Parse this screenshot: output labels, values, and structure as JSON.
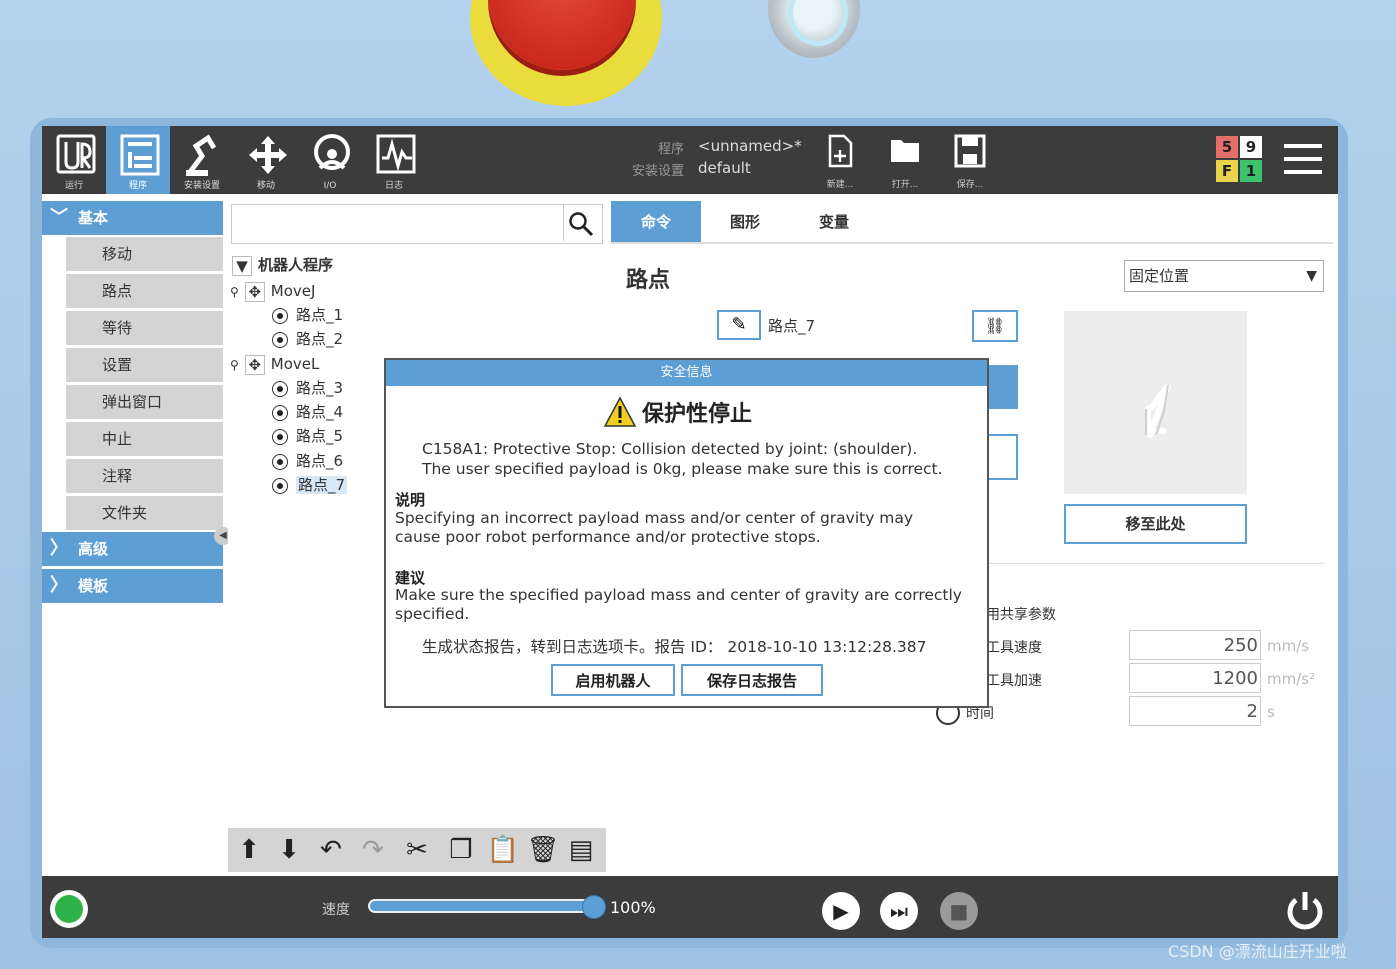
{
  "topbar": {
    "nav": [
      {
        "label": "运行",
        "icon": "ur-logo-icon"
      },
      {
        "label": "程序",
        "icon": "program-icon"
      },
      {
        "label": "安装设置",
        "icon": "installation-icon"
      },
      {
        "label": "移动",
        "icon": "move-icon"
      },
      {
        "label": "I/O",
        "icon": "io-icon"
      },
      {
        "label": "日志",
        "icon": "log-icon"
      }
    ],
    "program_label": "程序",
    "program_name": "<unnamed>*",
    "installation_label": "安装设置",
    "installation_name": "default",
    "file_buttons": [
      {
        "label": "新建...",
        "icon": "new-file-icon"
      },
      {
        "label": "打开...",
        "icon": "open-folder-icon"
      },
      {
        "label": "保存...",
        "icon": "save-icon"
      }
    ],
    "counters": {
      "c1": "5",
      "c2": "9",
      "c3": "F",
      "c4": "1"
    },
    "counter_colors": {
      "c1": "#e46f6a",
      "c2": "#ffffff",
      "c3": "#e8d44d",
      "c4": "#3cc26a"
    }
  },
  "sidebar": {
    "basic": "基本",
    "items": [
      "移动",
      "路点",
      "等待",
      "设置",
      "弹出窗口",
      "中止",
      "注释",
      "文件夹"
    ],
    "advanced": "高级",
    "templates": "模板"
  },
  "tree": {
    "root": "机器人程序",
    "movej": "MoveJ",
    "movej_children": [
      "路点_1",
      "路点_2"
    ],
    "movel": "MoveL",
    "movel_children": [
      "路点_3",
      "路点_4",
      "路点_5",
      "路点_6",
      "路点_7"
    ]
  },
  "tabs": [
    "命令",
    "图形",
    "变量"
  ],
  "waypoint": {
    "title": "路点",
    "type_select": "固定位置",
    "name": "路点_7",
    "move_here": "移至此处",
    "shared_params": "用共享参数",
    "tool_speed_label": "工具速度",
    "tool_accel_label": "工具加速",
    "time_label": "时间",
    "speed_value": "250",
    "speed_unit": "mm/s",
    "accel_value": "1200",
    "accel_unit": "mm/s²",
    "time_value": "2",
    "time_unit": "s"
  },
  "dialog": {
    "header": "安全信息",
    "title": "保护性停止",
    "line1": "C158A1: Protective Stop: Collision detected by joint: (shoulder).",
    "line2": "The user specified payload is 0kg, please make sure this is correct.",
    "explain_head": "说明",
    "explain1": "Specifying an incorrect payload mass and/or center of gravity may",
    "explain2": "cause poor robot performance and/or protective stops.",
    "suggest_head": "建议",
    "suggest1": "Make sure the specified payload mass and center of gravity are correctly",
    "suggest2": "specified.",
    "report": "生成状态报告，转到日志选项卡。报告 ID： 2018-10-10 13:12:28.387",
    "btn_enable": "启用机器人",
    "btn_save": "保存日志报告"
  },
  "bottombar": {
    "speed_label": "速度",
    "speed_value": "100%",
    "speed_fraction": 1.0
  },
  "watermark": "CSDN @漂流山庄开业啦"
}
